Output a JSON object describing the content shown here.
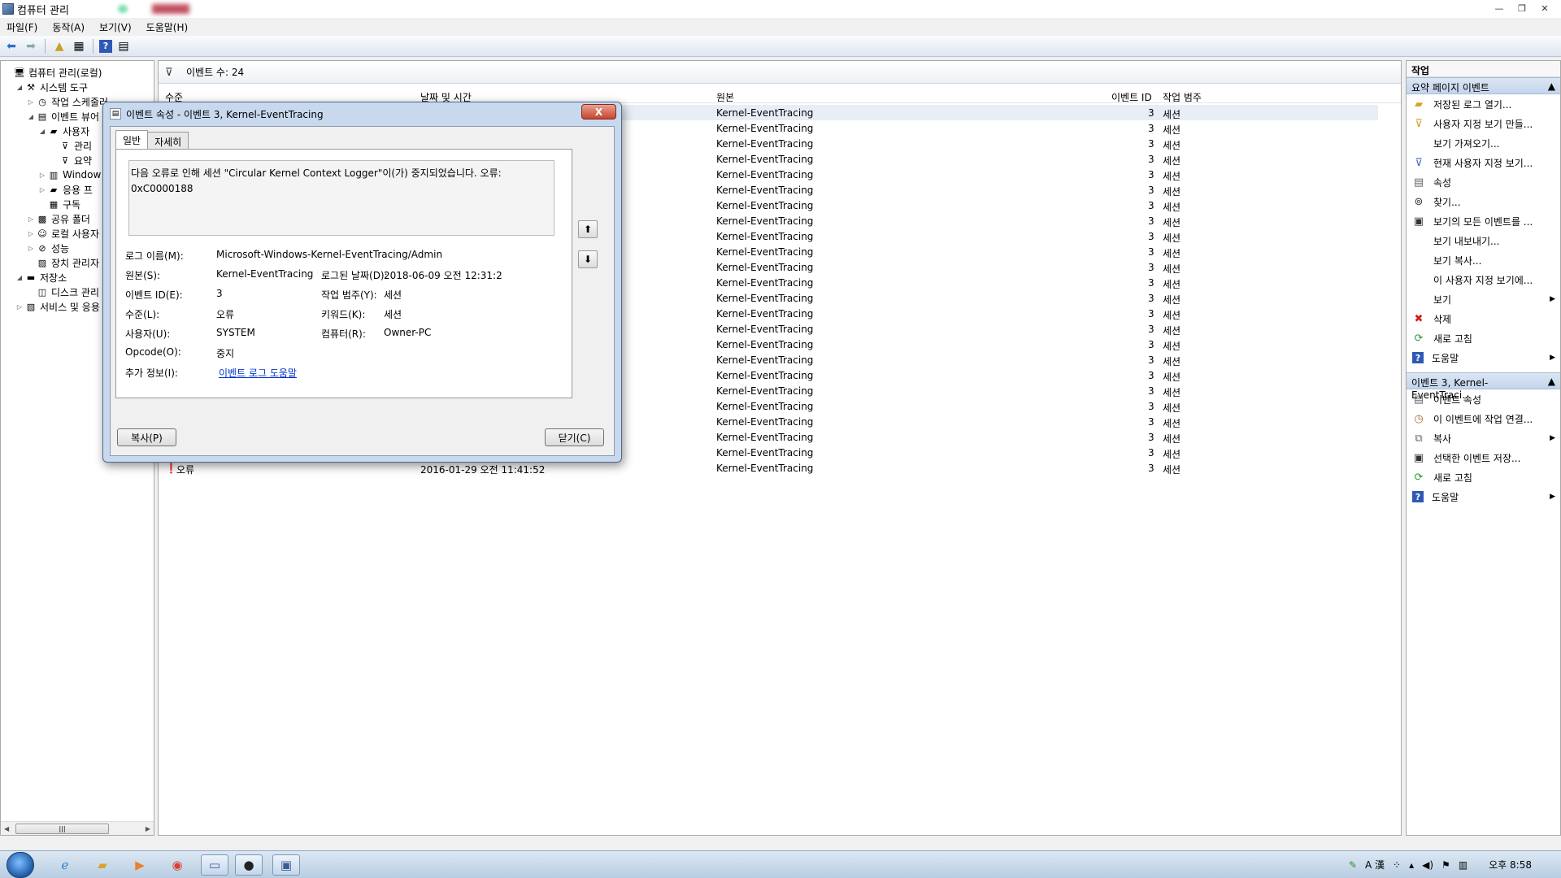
{
  "window": {
    "title": "컴퓨터 관리"
  },
  "menu": [
    "파일(F)",
    "동작(A)",
    "보기(V)",
    "도움말(H)"
  ],
  "tree": [
    {
      "label": "컴퓨터 관리(로컬)",
      "indent": 0,
      "exp": "",
      "icon": "computer-icon"
    },
    {
      "label": "시스템 도구",
      "indent": 1,
      "exp": "◢",
      "icon": "tools-icon"
    },
    {
      "label": "작업 스케줄러",
      "indent": 2,
      "exp": "▷",
      "icon": "clock-icon"
    },
    {
      "label": "이벤트 뷰어",
      "indent": 2,
      "exp": "◢",
      "icon": "eventviewer-icon"
    },
    {
      "label": "사용자",
      "indent": 3,
      "exp": "◢",
      "icon": "folder-icon"
    },
    {
      "label": "관리",
      "indent": 4,
      "exp": "",
      "icon": "filter-icon"
    },
    {
      "label": "요약",
      "indent": 4,
      "exp": "",
      "icon": "filter-icon"
    },
    {
      "label": "Window",
      "indent": 3,
      "exp": "▷",
      "icon": "log-icon"
    },
    {
      "label": "응용 프",
      "indent": 3,
      "exp": "▷",
      "icon": "folder-icon"
    },
    {
      "label": "구독",
      "indent": 3,
      "exp": "",
      "icon": "subscription-icon"
    },
    {
      "label": "공유 폴더",
      "indent": 2,
      "exp": "▷",
      "icon": "shared-folder-icon"
    },
    {
      "label": "로컬 사용자",
      "indent": 2,
      "exp": "▷",
      "icon": "users-icon"
    },
    {
      "label": "성능",
      "indent": 2,
      "exp": "▷",
      "icon": "performance-icon"
    },
    {
      "label": "장치 관리자",
      "indent": 2,
      "exp": "",
      "icon": "device-manager-icon"
    },
    {
      "label": "저장소",
      "indent": 1,
      "exp": "◢",
      "icon": "storage-icon"
    },
    {
      "label": "디스크 관리",
      "indent": 2,
      "exp": "",
      "icon": "disk-icon"
    },
    {
      "label": "서비스 및 응용",
      "indent": 1,
      "exp": "▷",
      "icon": "services-icon"
    }
  ],
  "main": {
    "filter_label": "이벤트 수: 24",
    "columns": [
      "수준",
      "날짜 및 시간",
      "원본",
      "이벤트 ID",
      "작업 범주"
    ],
    "rows_count_visible": 24,
    "row": {
      "source": "Kernel-EventTracing",
      "event_id": "3",
      "category": "세션"
    },
    "last_row": {
      "level": "오류",
      "datetime": "2016-01-29 오전 11:41:52"
    }
  },
  "actions": {
    "header": "작업",
    "section1": "요약 페이지 이벤트",
    "items1": [
      {
        "label": "저장된 로그 열기...",
        "icon": "open-folder-icon",
        "sub": false
      },
      {
        "label": "사용자 지정 보기 만들...",
        "icon": "create-filter-icon",
        "sub": false
      },
      {
        "label": "보기 가져오기...",
        "icon": "",
        "sub": false
      },
      {
        "label": "현재 사용자 지정 보기...",
        "icon": "filter-icon",
        "sub": false
      },
      {
        "label": "속성",
        "icon": "properties-icon",
        "sub": false
      },
      {
        "label": "찾기...",
        "icon": "binoculars-icon",
        "sub": false
      },
      {
        "label": "보기의 모든 이벤트를 ...",
        "icon": "save-icon",
        "sub": false
      },
      {
        "label": "보기 내보내기...",
        "icon": "",
        "sub": false
      },
      {
        "label": "보기 복사...",
        "icon": "",
        "sub": false
      },
      {
        "label": "이 사용자 지정 보기에...",
        "icon": "",
        "sub": false
      },
      {
        "label": "보기",
        "icon": "",
        "sub": true
      },
      {
        "label": "삭제",
        "icon": "delete-icon",
        "sub": false
      },
      {
        "label": "새로 고침",
        "icon": "refresh-icon",
        "sub": false
      },
      {
        "label": "도움말",
        "icon": "help-icon",
        "sub": true
      }
    ],
    "section2": "이벤트 3, Kernel-EventTraci...",
    "items2": [
      {
        "label": "이벤트 속성",
        "icon": "event-properties-icon",
        "sub": false
      },
      {
        "label": "이 이벤트에 작업 연결...",
        "icon": "task-icon",
        "sub": false
      },
      {
        "label": "복사",
        "icon": "copy-icon",
        "sub": true
      },
      {
        "label": "선택한 이벤트 저장...",
        "icon": "save-icon",
        "sub": false
      },
      {
        "label": "새로 고침",
        "icon": "refresh-icon",
        "sub": false
      },
      {
        "label": "도움말",
        "icon": "help-icon",
        "sub": true
      }
    ]
  },
  "dialog": {
    "title": "이벤트 속성 - 이벤트 3, Kernel-EventTracing",
    "close": "X",
    "tabs": [
      "일반",
      "자세히"
    ],
    "message_line1": "다음 오류로 인해 세션 \"Circular Kernel Context Logger\"이(가) 중지되었습니다. 오류:",
    "message_line2": "0xC0000188",
    "labels": {
      "log_name": "로그 이름(M):",
      "source": "원본(S):",
      "event_id": "이벤트 ID(E):",
      "level": "수준(L):",
      "user": "사용자(U):",
      "opcode": "Opcode(O):",
      "more_info": "추가 정보(I):",
      "logged": "로그된 날짜(D):",
      "task_category": "작업 범주(Y):",
      "keywords": "키워드(K):",
      "computer": "컴퓨터(R):"
    },
    "values": {
      "log_name": "Microsoft-Windows-Kernel-EventTracing/Admin",
      "source": "Kernel-EventTracing",
      "event_id": "3",
      "level": "오류",
      "user": "SYSTEM",
      "opcode": "중지",
      "more_info": "이벤트 로그 도움말",
      "logged": "2018-06-09 오전 12:31:2",
      "task_category": "세션",
      "keywords": "세션",
      "computer": "Owner-PC"
    },
    "copy_button": "복사(P)",
    "close_button": "닫기(C)"
  },
  "taskbar": {
    "clock": "오후 8:58",
    "ime": "A 漢"
  }
}
